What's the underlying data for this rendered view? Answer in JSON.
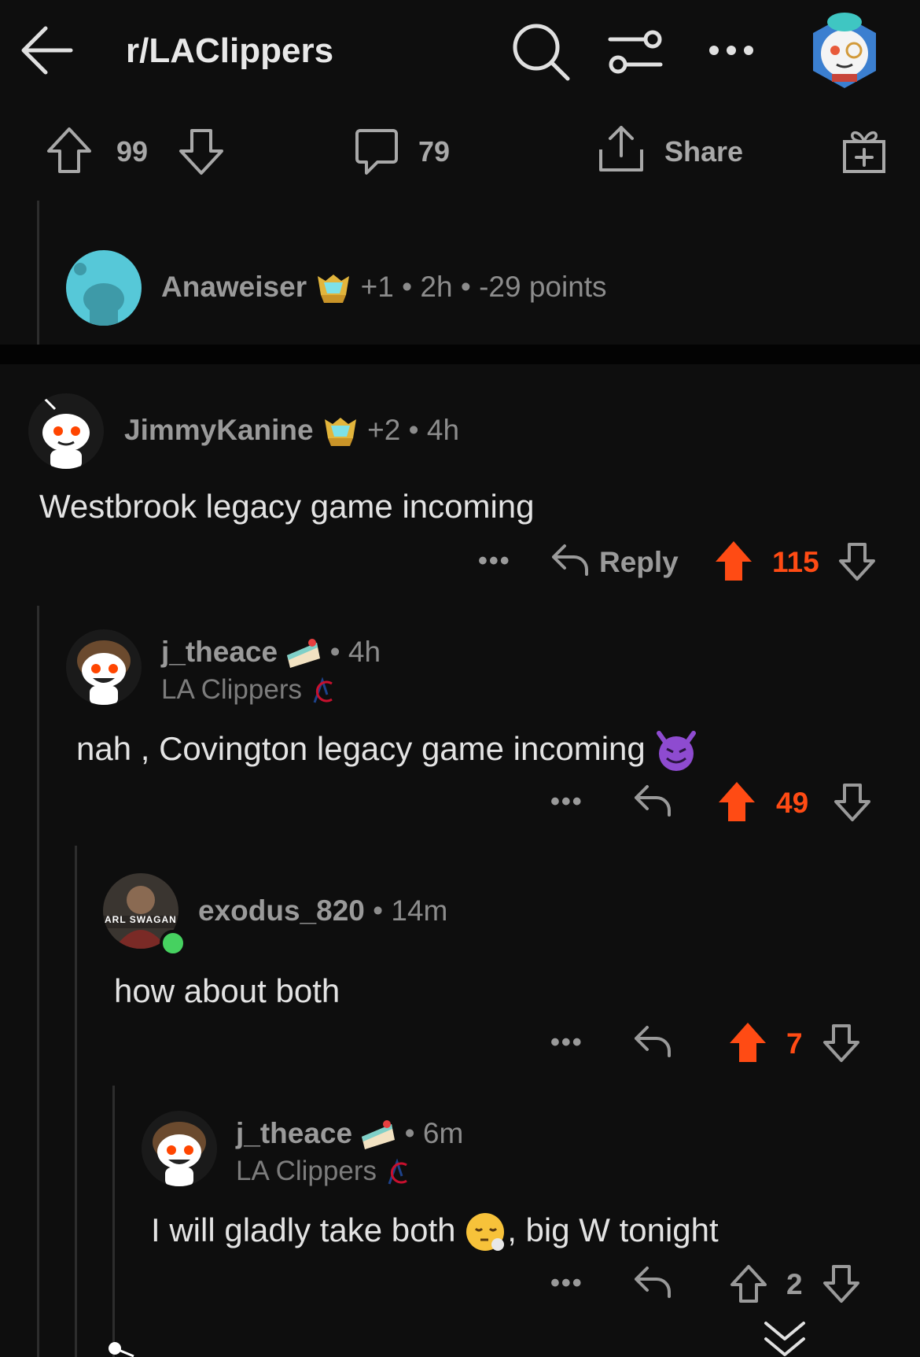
{
  "header": {
    "subreddit": "r/LAClippers",
    "icons": [
      "back-arrow-icon",
      "search-icon",
      "filter-sliders-icon",
      "more-icon",
      "user-avatar"
    ]
  },
  "post_actions": {
    "upvotes": "99",
    "comments": "79",
    "share_label": "Share"
  },
  "comments": [
    {
      "user": "Anaweiser",
      "award_count": "+1",
      "age": "2h",
      "points": "-29 points",
      "sep1": "•",
      "sep2": "•"
    },
    {
      "user": "JimmyKanine",
      "award_count": "+2",
      "age": "4h",
      "sep": "•",
      "body": "Westbrook legacy game incoming",
      "reply_label": "Reply",
      "votes": "115"
    },
    {
      "user": "j_theace",
      "age": "4h",
      "sep": "•",
      "flair": "LA Clippers",
      "body": "nah , Covington legacy game incoming",
      "votes": "49"
    },
    {
      "user": "exodus_820",
      "age": "14m",
      "sep": "•",
      "avatar_text": "ARL SWAGAN",
      "body": "how about both",
      "votes": "7"
    },
    {
      "user": "j_theace",
      "age": "6m",
      "sep": "•",
      "flair": "LA Clippers",
      "body_part1": "I will gladly take both",
      "body_part2": ", big W tonight",
      "votes": "2"
    }
  ],
  "colors": {
    "background": "#0e0e0e",
    "upvote_active": "#ff4b14",
    "muted": "#9a9a9a"
  }
}
